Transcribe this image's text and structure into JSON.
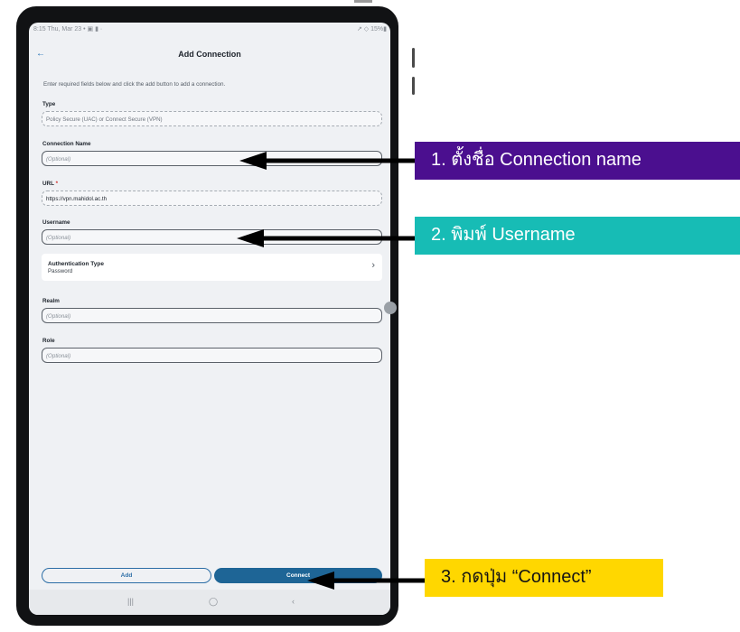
{
  "status_bar": {
    "left": "8:15  Thu, Mar 23  • ▣ ▮ ·",
    "right": "↗ ◇ 15%▮"
  },
  "appbar": {
    "back_icon": "←",
    "title": "Add Connection"
  },
  "intro": "Enter required fields below and click the add button to add a connection.",
  "form": {
    "type": {
      "label": "Type",
      "placeholder": "Policy Secure (UAC) or Connect Secure (VPN)"
    },
    "connection_name": {
      "label": "Connection Name",
      "placeholder": "(Optional)"
    },
    "url": {
      "label": "URL",
      "required_mark": " *",
      "value": "https://vpn.mahidol.ac.th"
    },
    "username": {
      "label": "Username",
      "placeholder": "(Optional)"
    },
    "auth_type": {
      "title": "Authentication Type",
      "value": "Password",
      "chevron": "›"
    },
    "realm": {
      "label": "Realm",
      "placeholder": "(Optional)"
    },
    "role": {
      "label": "Role",
      "placeholder": "(Optional)"
    }
  },
  "buttons": {
    "add": "Add",
    "connect": "Connect"
  },
  "navbar": {
    "recents": "|||",
    "home": "◯",
    "back": "‹"
  },
  "callouts": {
    "step1": "1. ตั้งชื่อ Connection name",
    "step2": "2. พิมพ์ Username",
    "step3": "3. กดปุ่ม “Connect”"
  },
  "colors": {
    "callout1": "#4b0f8f",
    "callout2": "#17bcb5",
    "callout3": "#ffd700",
    "primary": "#1e6596"
  }
}
